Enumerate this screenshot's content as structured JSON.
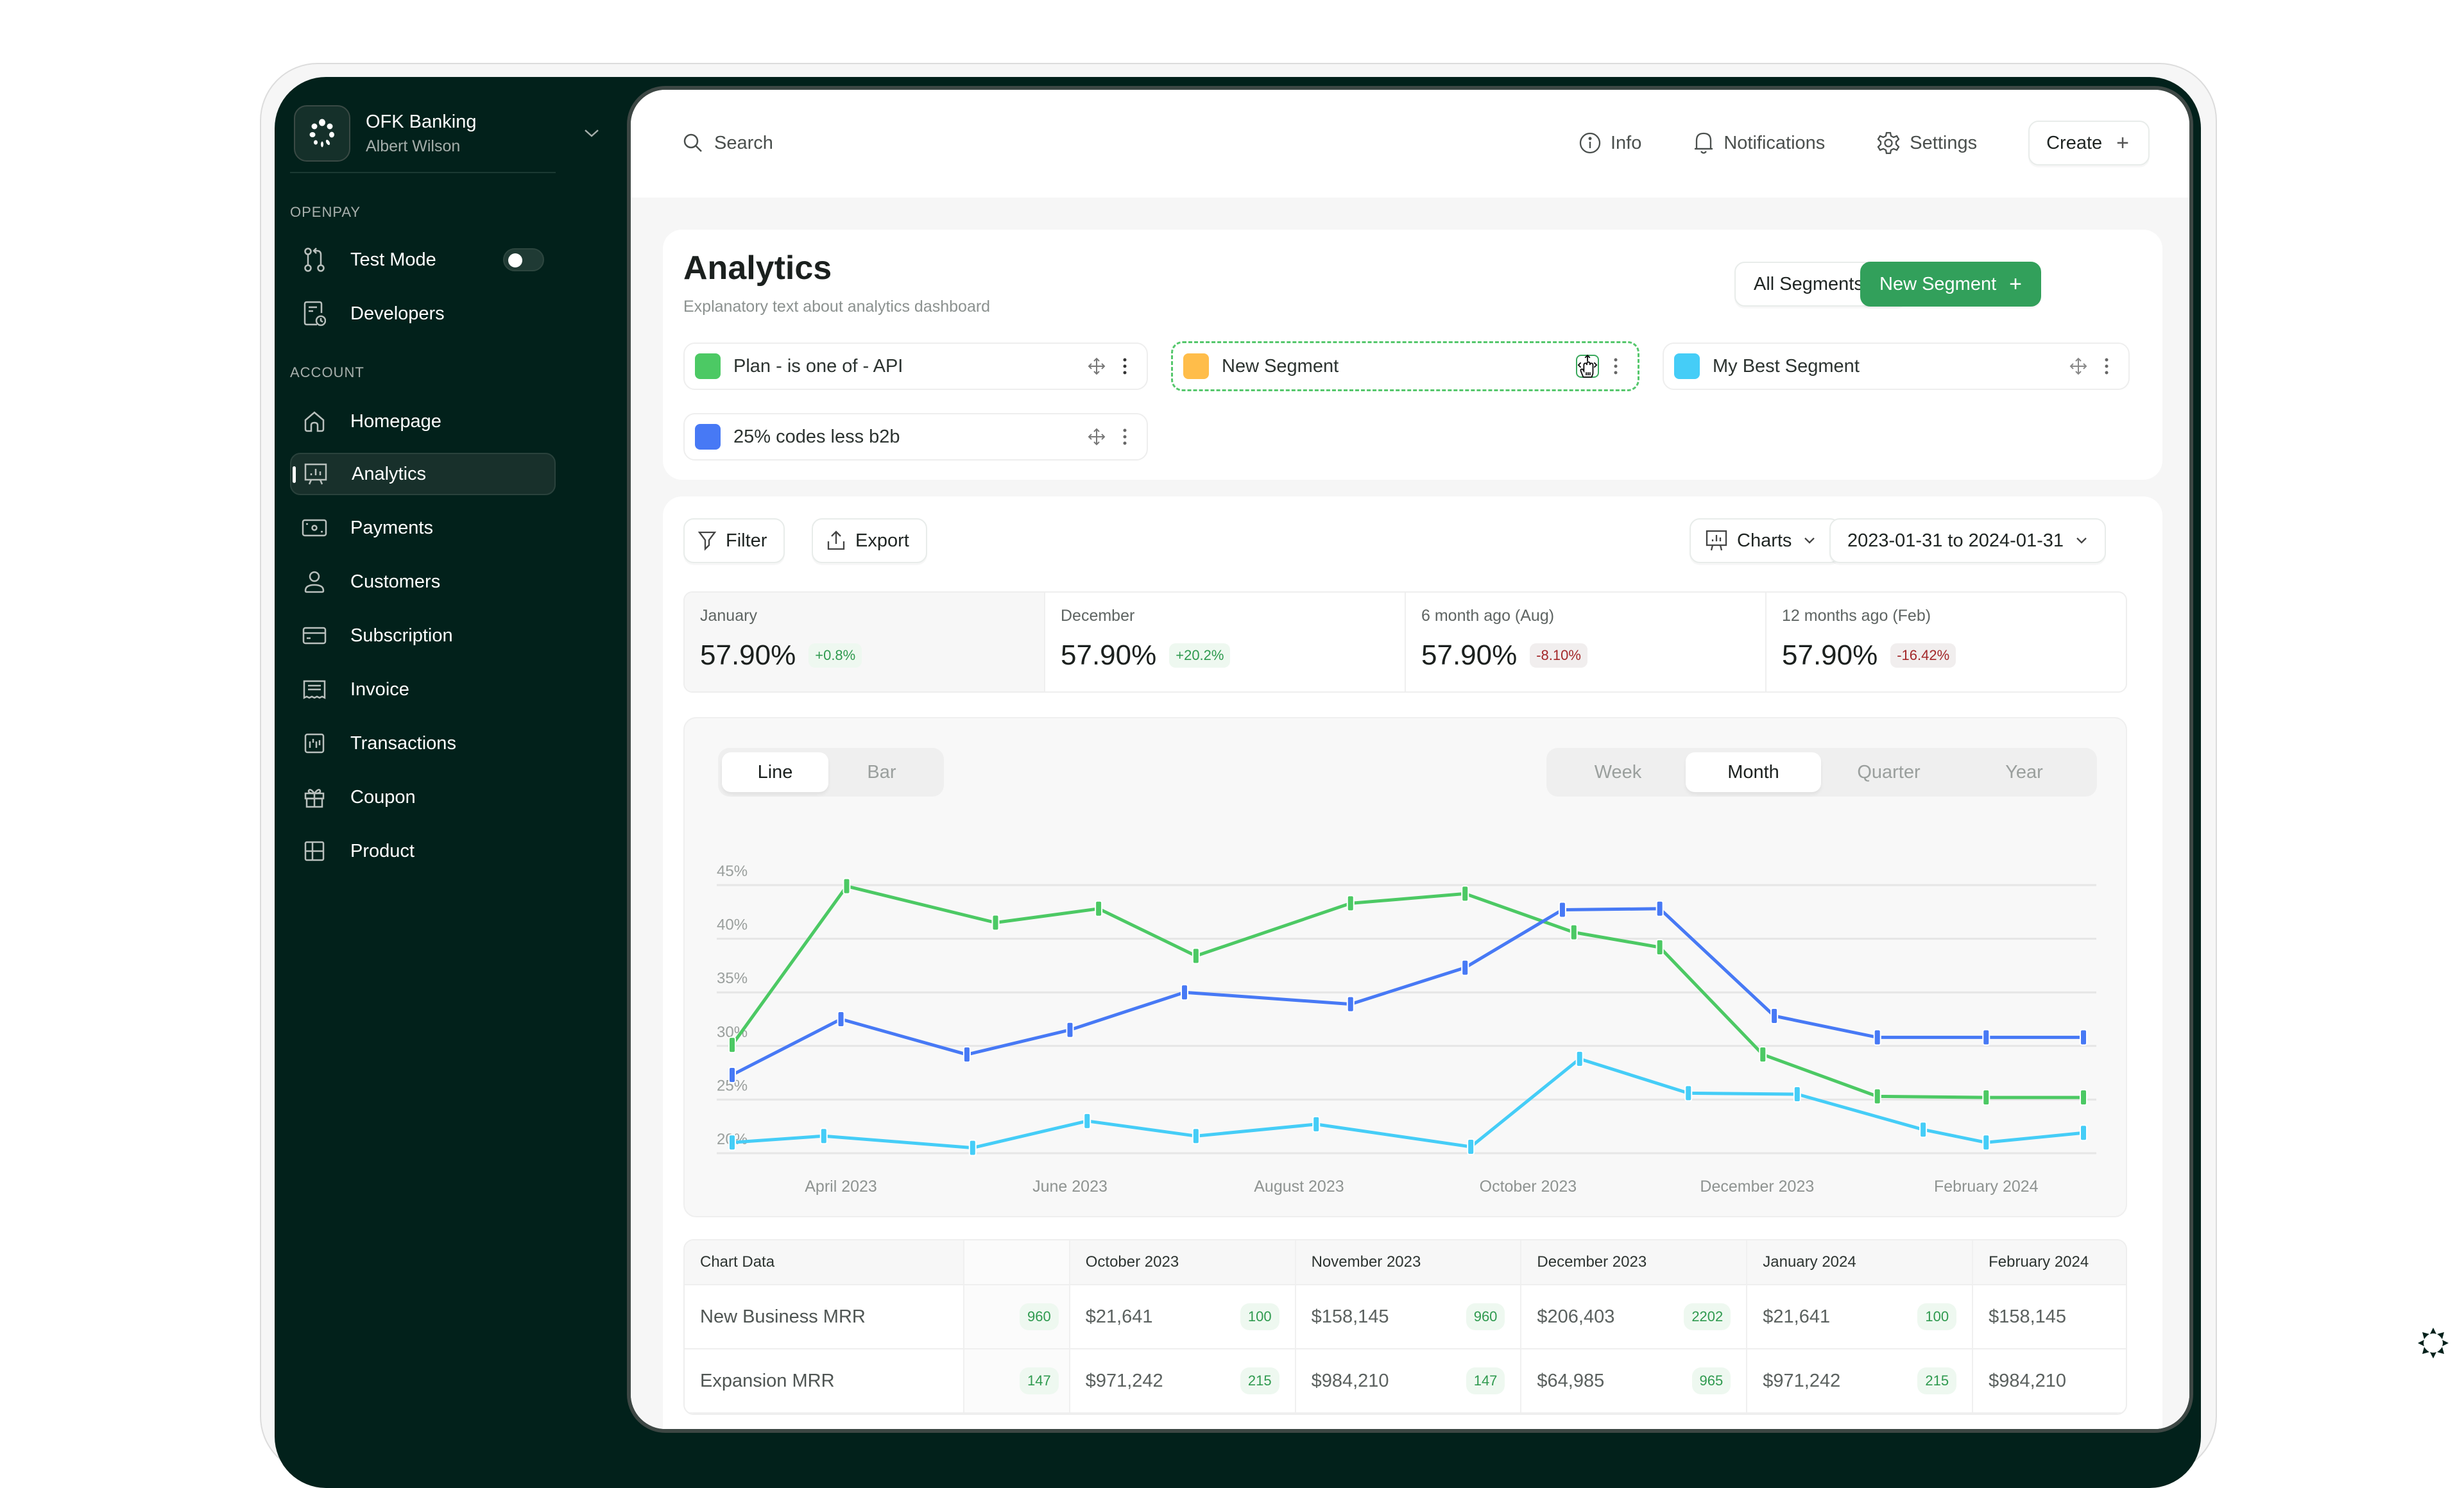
{
  "sidebar": {
    "org_name": "OFK Banking",
    "user_name": "Albert Wilson",
    "sections": [
      {
        "label": "OPENPAY",
        "items": [
          {
            "label": "Test Mode",
            "icon": "git-compare-icon",
            "toggle": false
          },
          {
            "label": "Developers",
            "icon": "developer-doc-icon"
          }
        ]
      },
      {
        "label": "ACCOUNT",
        "items": [
          {
            "label": "Homepage",
            "icon": "home-icon"
          },
          {
            "label": "Analytics",
            "icon": "analytics-icon",
            "active": true
          },
          {
            "label": "Payments",
            "icon": "banknote-icon"
          },
          {
            "label": "Customers",
            "icon": "user-icon"
          },
          {
            "label": "Subscription",
            "icon": "credit-card-icon"
          },
          {
            "label": "Invoice",
            "icon": "receipt-icon"
          },
          {
            "label": "Transactions",
            "icon": "chart-bars-icon"
          },
          {
            "label": "Coupon",
            "icon": "gift-icon"
          },
          {
            "label": "Product",
            "icon": "layout-grid-icon"
          }
        ]
      }
    ]
  },
  "topbar": {
    "search_label": "Search",
    "info_label": "Info",
    "notifications_label": "Notifications",
    "settings_label": "Settings",
    "create_label": "Create"
  },
  "header": {
    "title": "Analytics",
    "subtitle": "Explanatory text about analytics dashboard",
    "all_segments_label": "All Segments",
    "new_segment_label": "New Segment"
  },
  "segments": [
    {
      "label": "Plan - is one of - API",
      "color": "#4cc964"
    },
    {
      "label": "New Segment",
      "color": "#ffbd4a",
      "state": "dragging"
    },
    {
      "label": "My Best Segment",
      "color": "#45cdf7"
    },
    {
      "label": "25% codes less b2b",
      "color": "#4779f5"
    }
  ],
  "toolbar": {
    "filter_label": "Filter",
    "export_label": "Export",
    "charts_label": "Charts",
    "date_range": "2023-01-31 to 2024-01-31"
  },
  "stats": [
    {
      "label": "January",
      "value": "57.90%",
      "delta": "+0.8%",
      "trend": "up"
    },
    {
      "label": "December",
      "value": "57.90%",
      "delta": "+20.2%",
      "trend": "up"
    },
    {
      "label": "6 month ago (Aug)",
      "value": "57.90%",
      "delta": "-8.10%",
      "trend": "down"
    },
    {
      "label": "12 months ago (Feb)",
      "value": "57.90%",
      "delta": "-16.42%",
      "trend": "down"
    }
  ],
  "chart_controls": {
    "type_options": [
      "Line",
      "Bar"
    ],
    "type_selected": "Line",
    "period_options": [
      "Week",
      "Month",
      "Quarter",
      "Year"
    ],
    "period_selected": "Month"
  },
  "chart_data": {
    "type": "line",
    "title": "",
    "xlabel": "",
    "ylabel": "",
    "x_ticks": [
      "April 2023",
      "June 2023",
      "August 2023",
      "October 2023",
      "December 2023",
      "February 2024"
    ],
    "x_tick_positions_months": [
      1,
      3,
      5,
      7,
      9,
      11
    ],
    "x_range_months": [
      0.05,
      11.85
    ],
    "y_ticks": [
      "20%",
      "25%",
      "30%",
      "35%",
      "40%",
      "45%"
    ],
    "ylim": [
      20,
      45
    ],
    "grid": true,
    "series": [
      {
        "name": "Plan - is one of - API",
        "color": "#4cc964",
        "x": [
          0.05,
          1.05,
          2.35,
          3.25,
          4.1,
          5.45,
          6.45,
          7.4,
          8.15,
          9.05,
          10.05,
          11.0,
          11.85
        ],
        "values": [
          30.1,
          44.9,
          41.5,
          42.8,
          38.4,
          43.3,
          44.2,
          40.6,
          39.2,
          29.2,
          25.3,
          25.2,
          25.2
        ]
      },
      {
        "name": "25% codes less b2b",
        "color": "#4779f5",
        "x": [
          0.05,
          1.0,
          2.1,
          3.0,
          4.0,
          5.45,
          6.45,
          7.3,
          8.15,
          9.15,
          10.05,
          11.0,
          11.85
        ],
        "values": [
          27.3,
          32.5,
          29.2,
          31.5,
          35.0,
          33.9,
          37.3,
          42.7,
          42.8,
          32.8,
          30.8,
          30.8,
          30.8
        ],
        "_note": "values read from gridlines"
      },
      {
        "name": "My Best Segment",
        "color": "#45cdf7",
        "x": [
          0.05,
          0.85,
          2.15,
          3.15,
          4.1,
          5.15,
          6.5,
          7.45,
          8.4,
          9.35,
          10.45,
          11.0,
          11.85
        ],
        "values": [
          21.0,
          21.6,
          20.5,
          23.0,
          21.6,
          22.7,
          20.6,
          28.8,
          25.6,
          25.5,
          22.2,
          21.0,
          21.9
        ]
      }
    ]
  },
  "table": {
    "headers": [
      "Chart Data",
      "",
      "October 2023",
      "November 2023",
      "December 2023",
      "January 2024",
      "February 2024"
    ],
    "rows": [
      {
        "label": "New Business MRR",
        "badge": "960",
        "cells": [
          {
            "value": "$21,641",
            "badge": "100"
          },
          {
            "value": "$158,145",
            "badge": "960"
          },
          {
            "value": "$206,403",
            "badge": "2202"
          },
          {
            "value": "$21,641",
            "badge": "100"
          },
          {
            "value": "$158,145",
            "badge": ""
          }
        ]
      },
      {
        "label": "Expansion MRR",
        "badge": "147",
        "cells": [
          {
            "value": "$971,242",
            "badge": "215"
          },
          {
            "value": "$984,210",
            "badge": "147"
          },
          {
            "value": "$64,985",
            "badge": "965"
          },
          {
            "value": "$971,242",
            "badge": "215"
          },
          {
            "value": "$984,210",
            "badge": ""
          }
        ]
      }
    ]
  },
  "colors": {
    "sidebar_bg": "#02211b",
    "accent_green": "#32a05b",
    "positive": "#2f9a4f",
    "negative": "#a3282a"
  }
}
